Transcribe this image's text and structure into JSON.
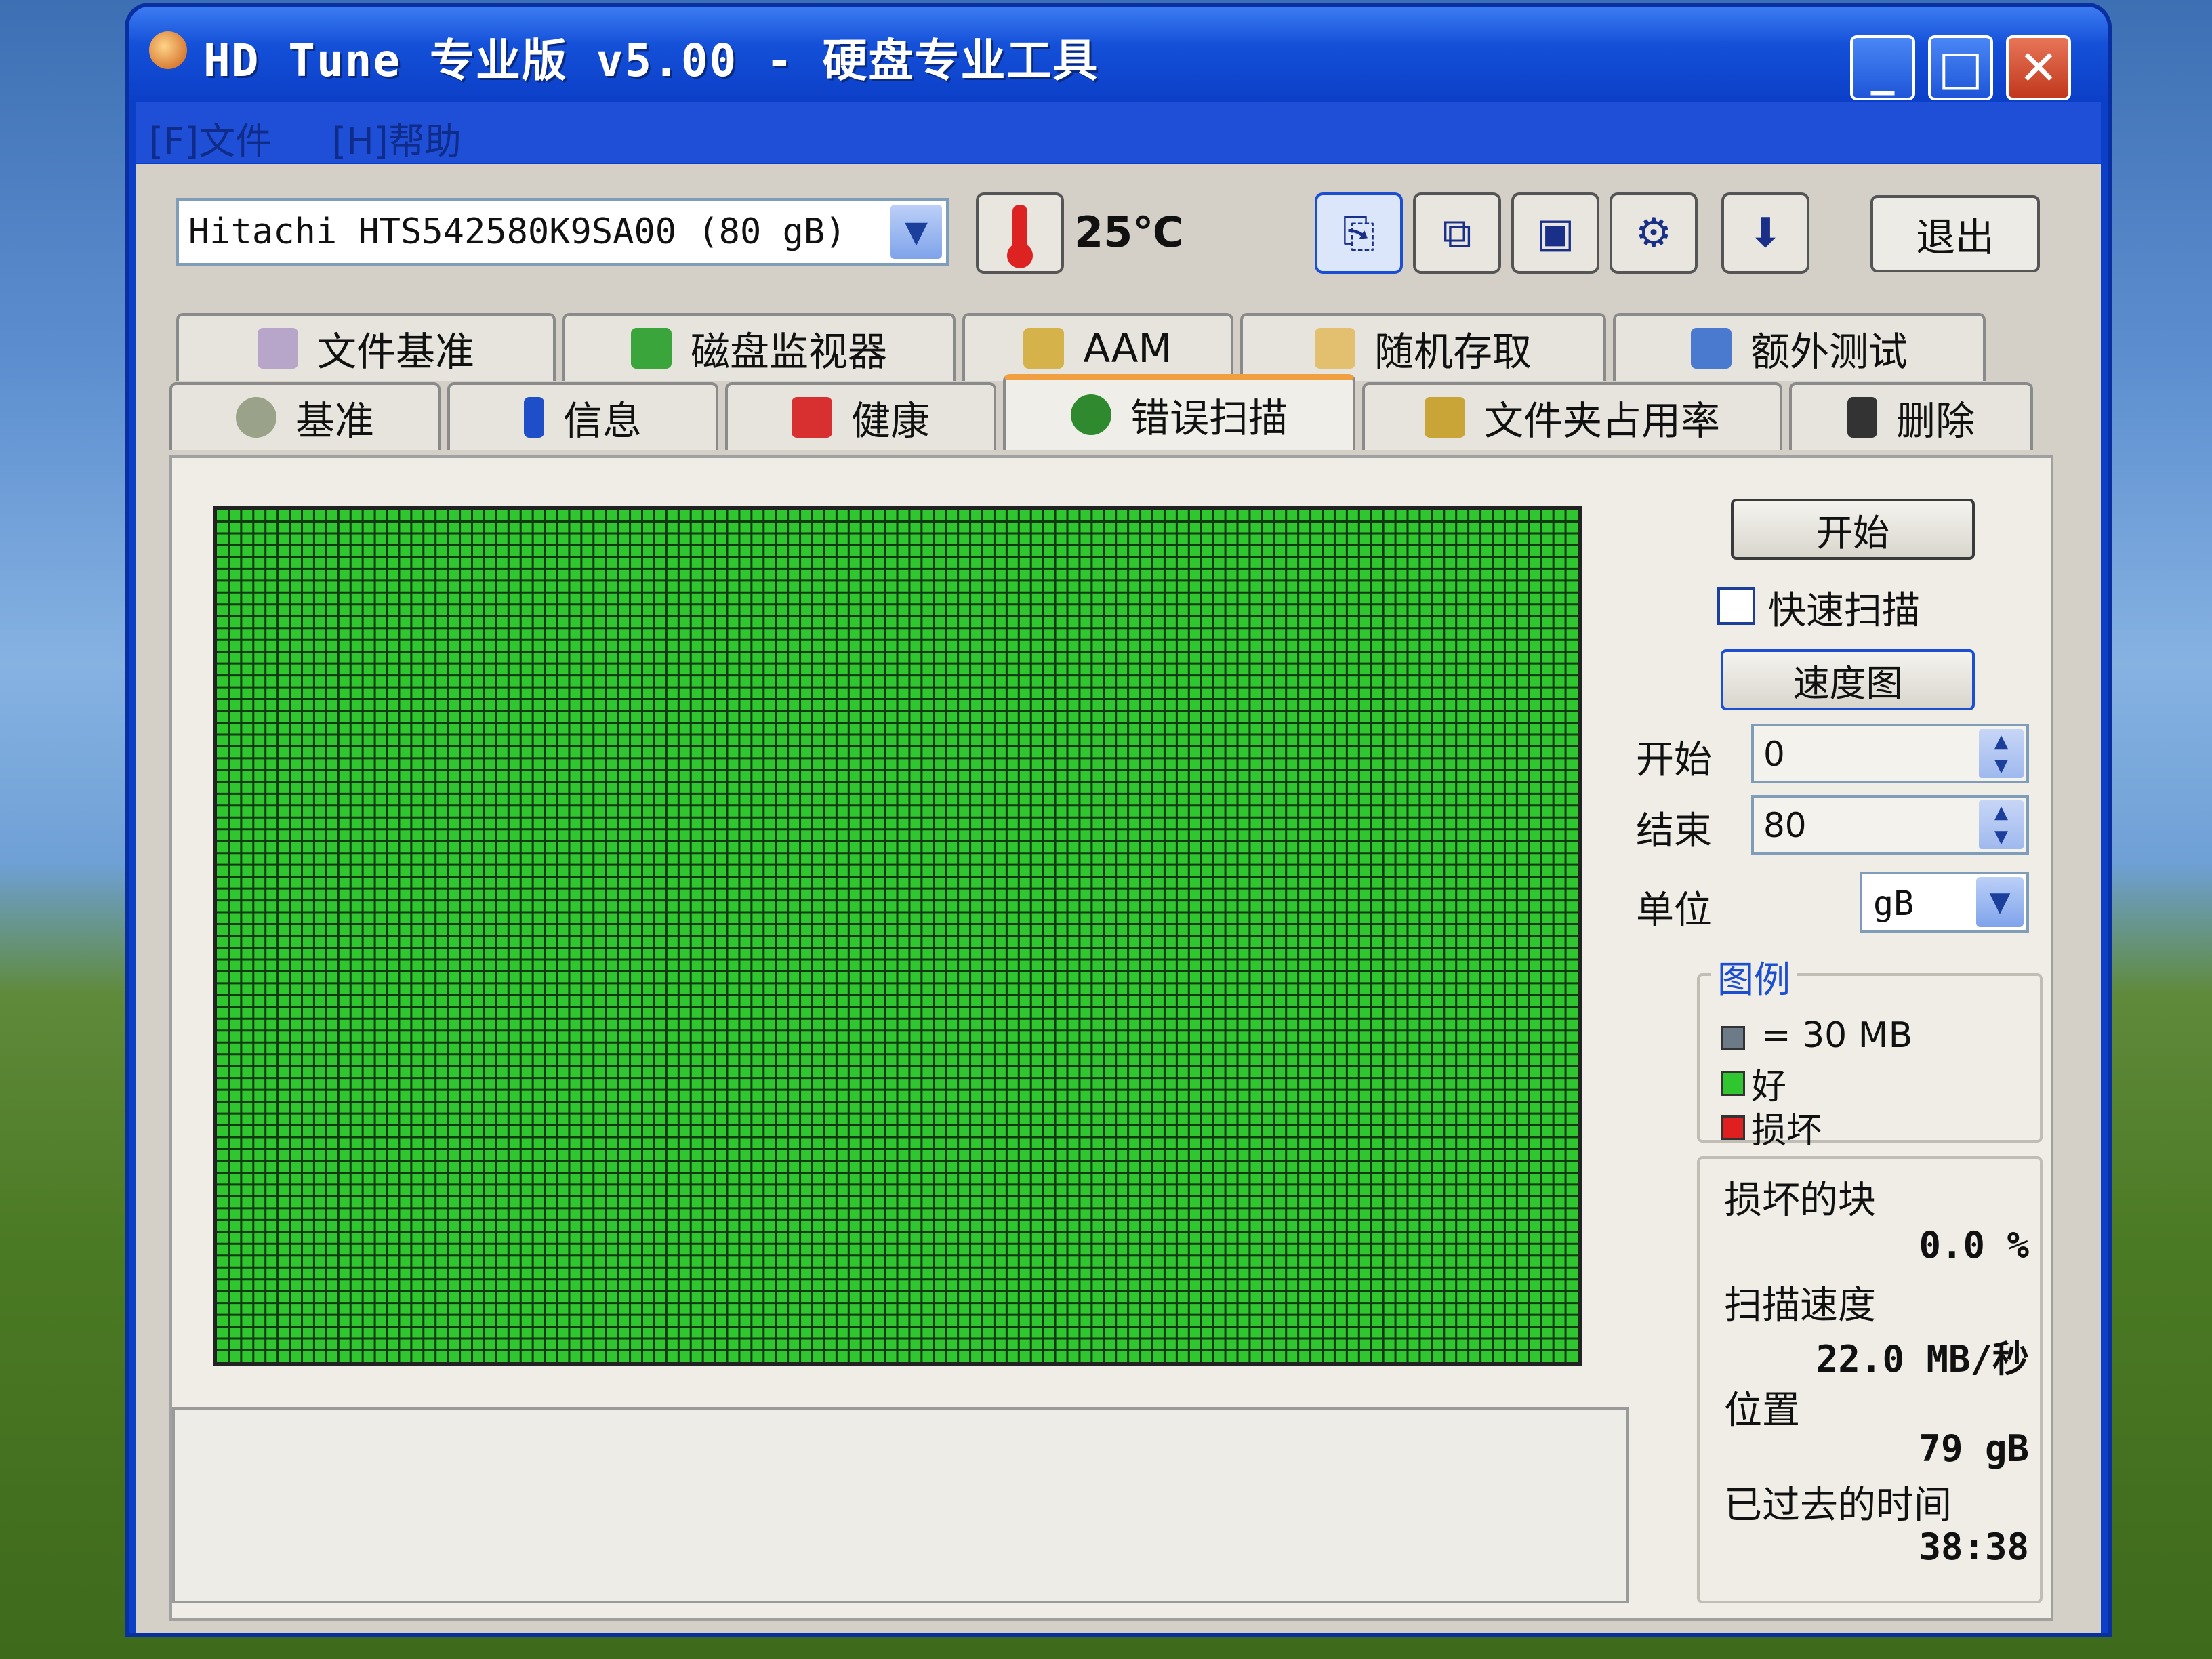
{
  "window": {
    "title": "HD Tune 专业版 v5.00 - 硬盘专业工具"
  },
  "menu": {
    "file": "[F]文件",
    "help": "[H]帮助"
  },
  "toolbar": {
    "drive": "Hitachi HTS542580K9SA00 (80 gB)",
    "temperature": "25℃",
    "exit_label": "退出",
    "buttons": [
      "copy-info-icon",
      "copy-screen-icon",
      "save-icon",
      "options-icon",
      "download-icon"
    ]
  },
  "tabs": {
    "row1": [
      "文件基准",
      "磁盘监视器",
      "AAM",
      "随机存取",
      "额外测试"
    ],
    "row2": [
      "基准",
      "信息",
      "健康",
      "错误扫描",
      "文件夹占用率",
      "删除"
    ],
    "active": "错误扫描"
  },
  "scan": {
    "start_button": "开始",
    "quick_scan_label": "快速扫描",
    "quick_scan_checked": false,
    "speed_map_button": "速度图",
    "start_label": "开始",
    "start_value": "0",
    "end_label": "结束",
    "end_value": "80",
    "unit_label": "单位",
    "unit_value": "gB",
    "grid_color_good": "#2fc62f",
    "grid_status": "all-good"
  },
  "legend": {
    "title": "图例",
    "block_size": "= 30 MB",
    "good": "好",
    "damaged": "损坏",
    "colors": {
      "block": "#6d7a88",
      "good": "#2fc62f",
      "damaged": "#e02020"
    }
  },
  "stats": {
    "damaged_blocks_label": "损坏的块",
    "damaged_blocks_value": "0.0 %",
    "scan_speed_label": "扫描速度",
    "scan_speed_value": "22.0 MB/秒",
    "position_label": "位置",
    "position_value": "79 gB",
    "elapsed_label": "已过去的时间",
    "elapsed_value": "38:38"
  }
}
